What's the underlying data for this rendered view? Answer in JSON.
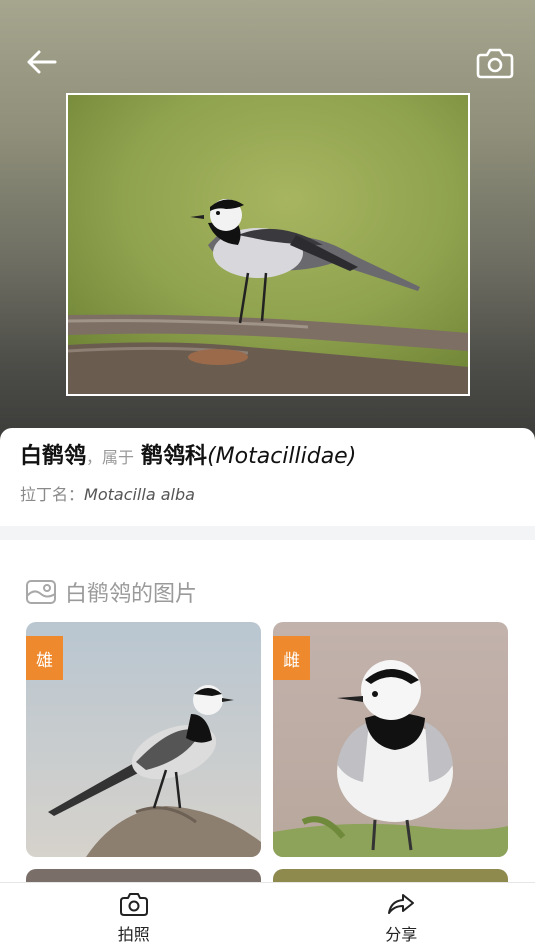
{
  "header": {
    "back_icon": "arrow-left-icon",
    "camera_icon": "camera-icon"
  },
  "species": {
    "name_cn": "白鹡鸰",
    "separator": "，",
    "belongs_label": "属于",
    "family_cn": "鹡鸰科",
    "family_latin": "(Motacillidae)",
    "latin_label": "拉丁名：",
    "latin_name": "Motacilla alba"
  },
  "gallery": {
    "icon": "image-icon",
    "title": "白鹡鸰的图片",
    "items": [
      {
        "tag": "雄"
      },
      {
        "tag": "雌"
      }
    ]
  },
  "bottom_nav": {
    "take_photo_label": "拍照",
    "share_label": "分享"
  },
  "colors": {
    "accent": "#ee8a2d",
    "divider": "#f2f4f6"
  }
}
